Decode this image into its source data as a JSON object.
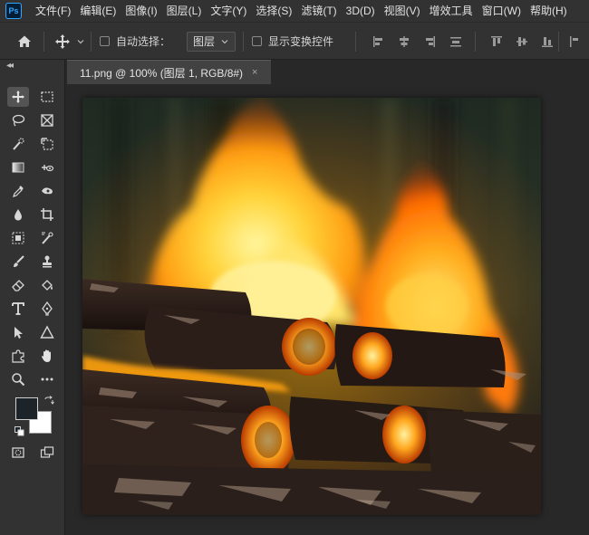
{
  "app": {
    "logo_text": "Ps",
    "accent_color": "#31a8ff"
  },
  "menu": {
    "items": [
      "文件(F)",
      "编辑(E)",
      "图像(I)",
      "图层(L)",
      "文字(Y)",
      "选择(S)",
      "滤镜(T)",
      "3D(D)",
      "视图(V)",
      "增效工具",
      "窗口(W)",
      "帮助(H)"
    ]
  },
  "options": {
    "auto_select_label": "自动选择：",
    "auto_select_value": "图层",
    "show_transform_label": "显示变换控件",
    "auto_select_checked": false,
    "show_transform_checked": false
  },
  "document": {
    "tab_title": "11.png @ 100% (图层 1, RGB/8#)",
    "close_glyph": "×",
    "image_subject": "campfire-logs"
  },
  "colors": {
    "foreground": "#1d2429",
    "background": "#ffffff"
  },
  "tools": [
    "move-tool",
    "marquee-tool",
    "lasso-tool",
    "frame-tool",
    "quick-select-tool",
    "slice-tool",
    "gradient-tool",
    "content-aware-move-tool",
    "eyedropper-tool",
    "smudge-tool",
    "blur-tool",
    "crop-tool",
    "spot-healing-tool",
    "color-replace-tool",
    "brush-tool",
    "stamp-tool",
    "eraser-tool",
    "paint-bucket-tool",
    "type-tool",
    "pen-tool",
    "path-select-tool",
    "shape-tool",
    "custom-shape-tool",
    "hand-tool",
    "zoom-tool",
    "more-tools",
    "quick-mask-tool",
    "screen-mode-tool"
  ]
}
